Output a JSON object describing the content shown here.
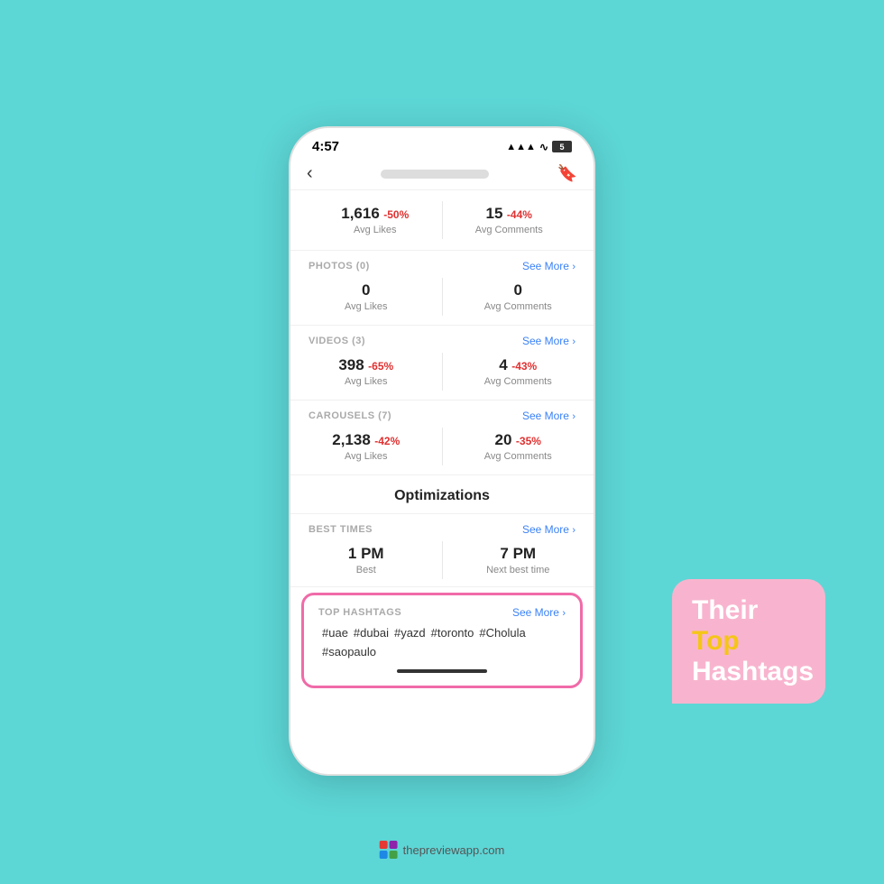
{
  "background_color": "#5dd6d6",
  "status_bar": {
    "time": "4:57",
    "signal": "▲▲▲",
    "wifi": "WiFi",
    "battery": "5"
  },
  "nav": {
    "back_icon": "‹",
    "title_placeholder": "username blurred",
    "bookmark_icon": "⌗"
  },
  "main_stats": {
    "avg_likes_value": "1,616",
    "avg_likes_change": "-50%",
    "avg_likes_label": "Avg Likes",
    "avg_comments_value": "15",
    "avg_comments_change": "-44%",
    "avg_comments_label": "Avg Comments"
  },
  "photos_section": {
    "title": "PHOTOS (0)",
    "see_more": "See More",
    "avg_likes_value": "0",
    "avg_likes_label": "Avg Likes",
    "avg_comments_value": "0",
    "avg_comments_label": "Avg Comments"
  },
  "videos_section": {
    "title": "VIDEOS (3)",
    "see_more": "See More",
    "avg_likes_value": "398",
    "avg_likes_change": "-65%",
    "avg_likes_label": "Avg Likes",
    "avg_comments_value": "4",
    "avg_comments_change": "-43%",
    "avg_comments_label": "Avg Comments"
  },
  "carousels_section": {
    "title": "CAROUSELS (7)",
    "see_more": "See More",
    "avg_likes_value": "2,138",
    "avg_likes_change": "-42%",
    "avg_likes_label": "Avg Likes",
    "avg_comments_value": "20",
    "avg_comments_change": "-35%",
    "avg_comments_label": "Avg Comments"
  },
  "optimizations": {
    "heading": "Optimizations"
  },
  "best_times": {
    "title": "BEST TIMES",
    "see_more": "See More",
    "time1_value": "1 PM",
    "time1_label": "Best",
    "time2_value": "7 PM",
    "time2_label": "Next best time"
  },
  "top_hashtags": {
    "title": "TOP HASHTAGS",
    "see_more": "See More",
    "tags": [
      "#uae",
      "#dubai",
      "#yazd",
      "#toronto",
      "#Cholula",
      "#saopaulo"
    ]
  },
  "label_card": {
    "line1": "Their",
    "line2": "Top",
    "line3": "Hashtags"
  },
  "watermark": {
    "text": "thepreviewapp.com"
  }
}
